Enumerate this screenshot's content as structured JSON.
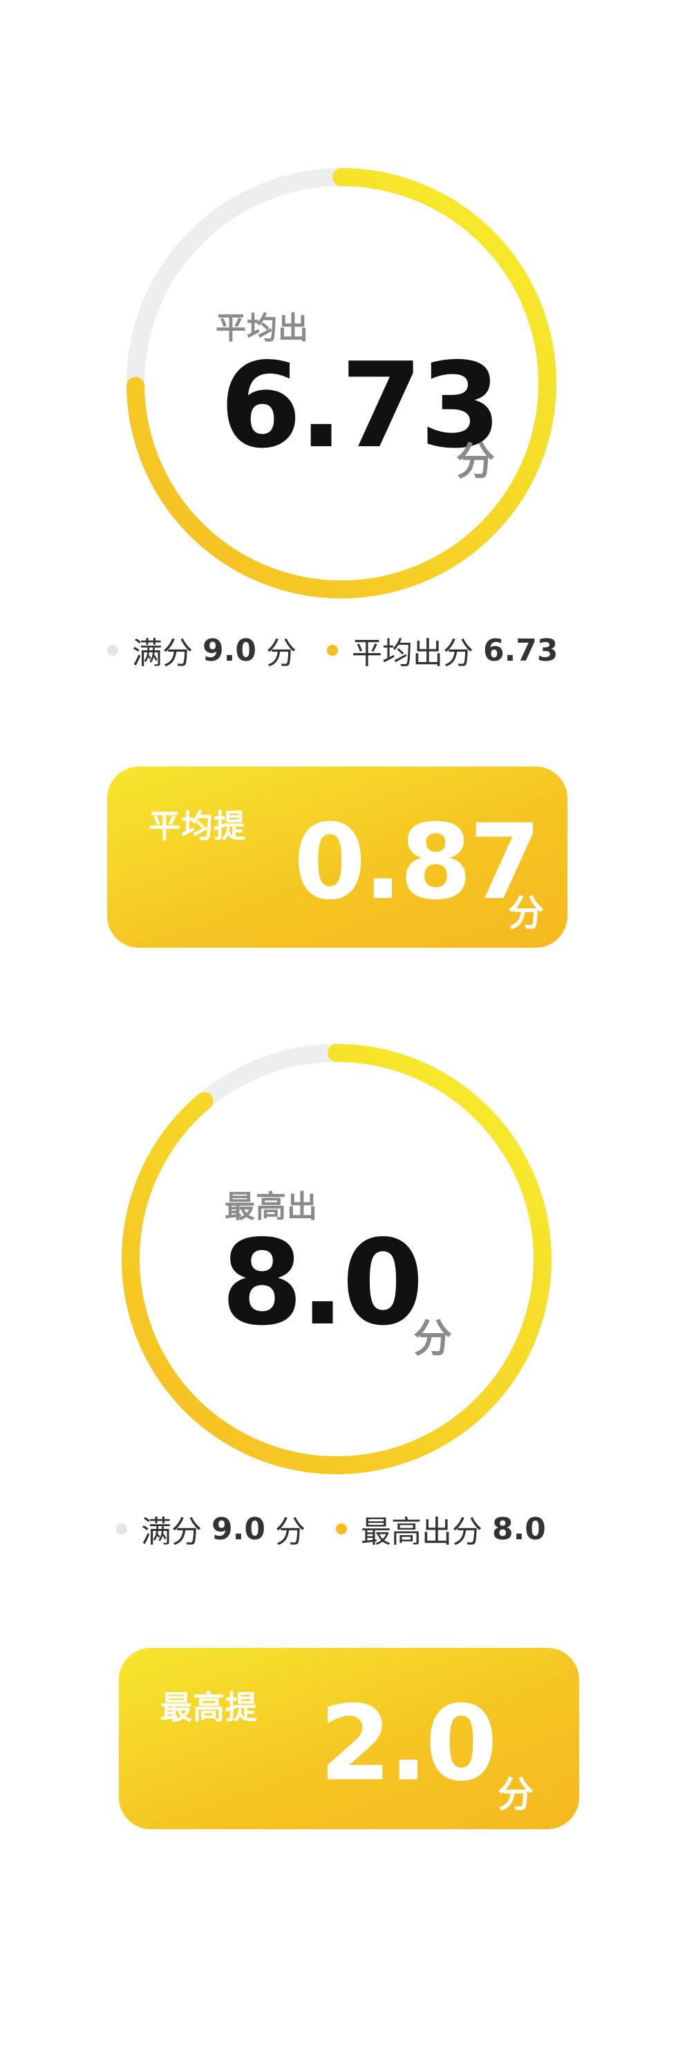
{
  "colors": {
    "track": "#eeeeee",
    "arc_start": "#f5bd22",
    "arc_end": "#f7ef2d",
    "dot_full": "#e4e4e4",
    "dot_score": "#f5bd22"
  },
  "average": {
    "label": "平均出",
    "value": "6.73",
    "unit": "分",
    "progress": 0.748,
    "legend": {
      "full_label": "满分",
      "full_value": "9.0",
      "full_unit": "分",
      "score_label": "平均出分",
      "score_value": "6.73"
    },
    "card": {
      "label": "平均提",
      "value": "0.87",
      "unit": "分"
    }
  },
  "highest": {
    "label": "最高出",
    "value": "8.0",
    "unit": "分",
    "progress": 0.889,
    "legend": {
      "full_label": "满分",
      "full_value": "9.0",
      "full_unit": "分",
      "score_label": "最高出分",
      "score_value": "8.0"
    },
    "card": {
      "label": "最高提",
      "value": "2.0",
      "unit": "分"
    }
  }
}
